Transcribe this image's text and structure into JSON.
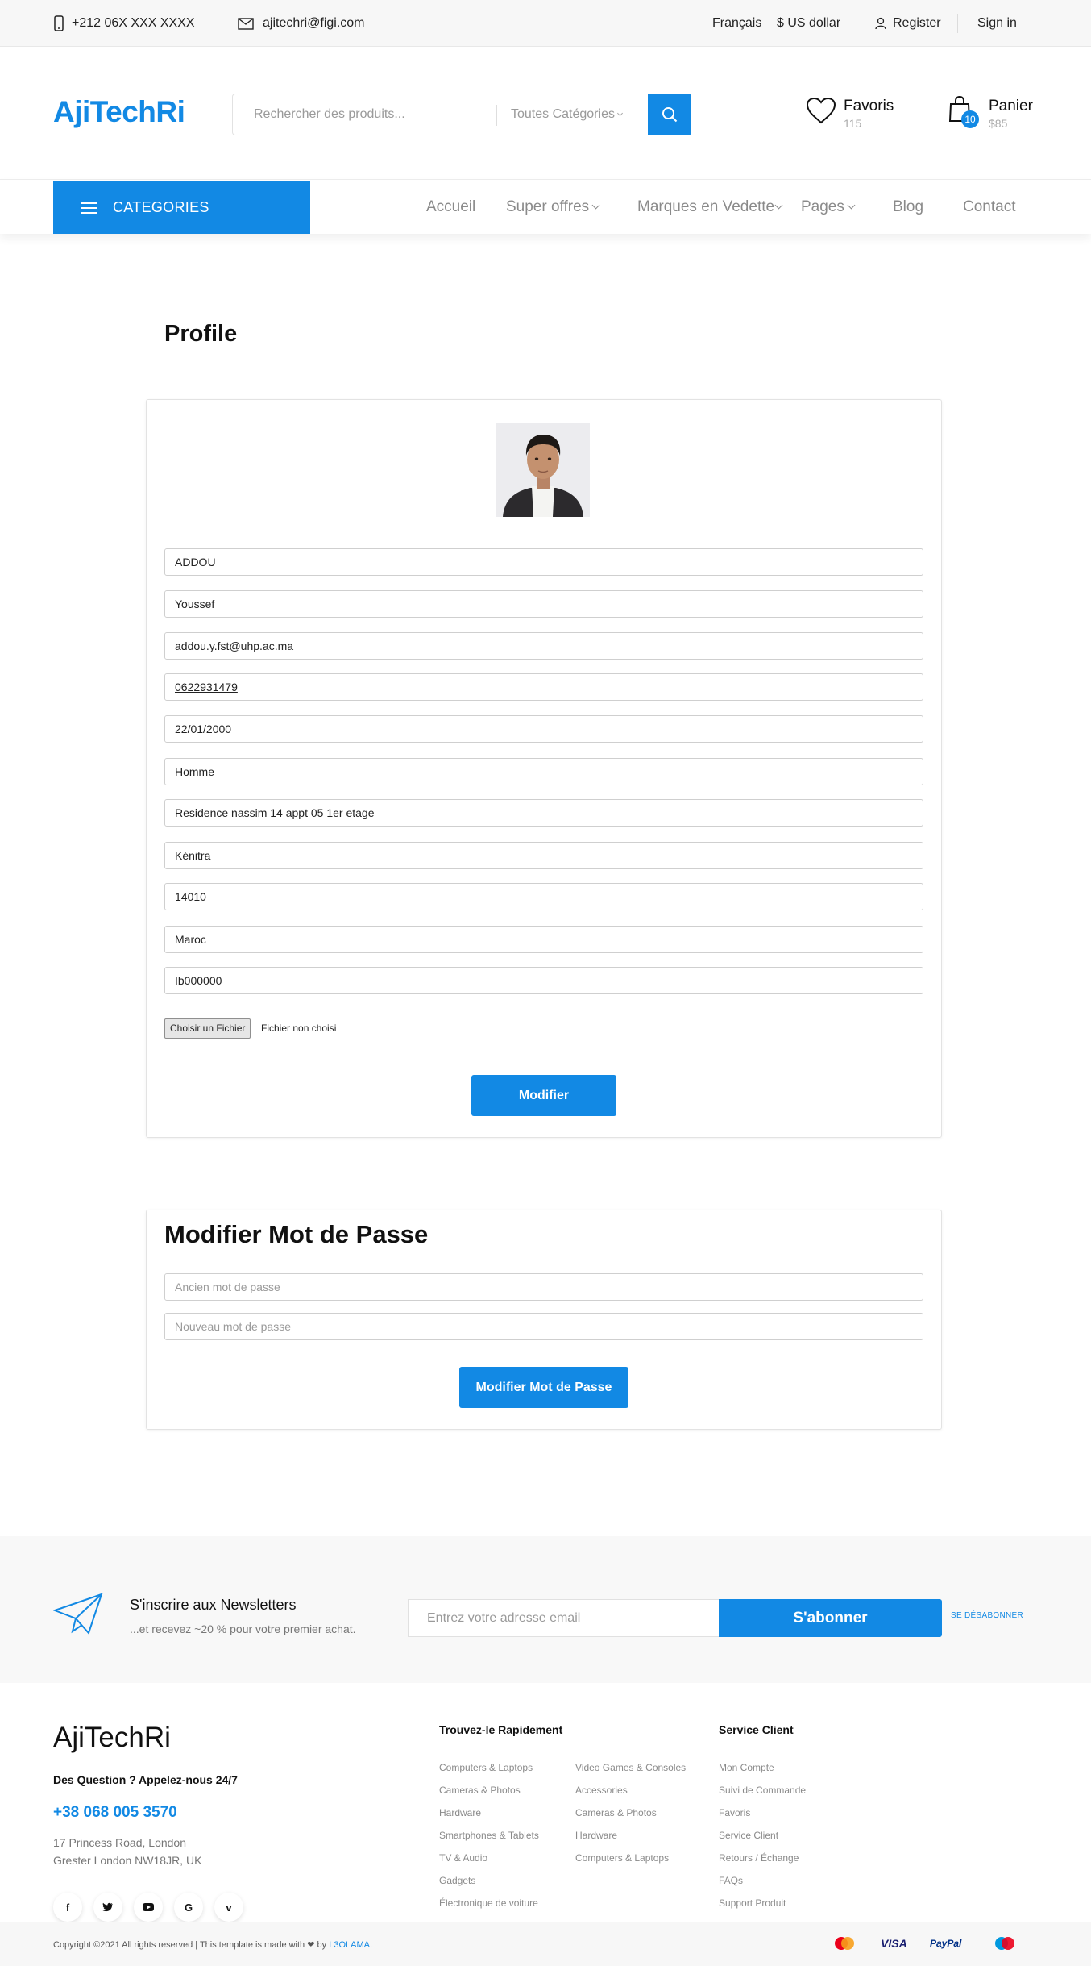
{
  "topbar": {
    "phone": "+212 06X XXX XXXX",
    "email": "ajitechri@figi.com",
    "language": "Français",
    "currency": "$ US dollar",
    "register": "Register",
    "signin": "Sign in"
  },
  "header": {
    "logo": "AjiTechRi",
    "search_placeholder": "Rechercher des produits...",
    "category_select": "Toutes Catégories",
    "favorites_label": "Favoris",
    "favorites_count": "115",
    "cart_label": "Panier",
    "cart_total": "$85",
    "cart_badge": "10"
  },
  "nav": {
    "categories": "CATEGORIES",
    "links": [
      "Accueil",
      "Super offres",
      "Marques en Vedette",
      "Pages",
      "Blog",
      "Contact"
    ]
  },
  "profile": {
    "title": "Profile",
    "fields": {
      "last_name": "ADDOU",
      "first_name": "Youssef",
      "email": "addou.y.fst@uhp.ac.ma",
      "phone": "0622931479",
      "birthdate": "22/01/2000",
      "gender": "Homme",
      "address": "Residence nassim 14 appt 05 1er etage",
      "city": "Kénitra",
      "postal_code": "14010",
      "country": "Maroc",
      "id_number": "Ib000000"
    },
    "file_button": "Choisir un Fichier",
    "file_status": "Fichier non choisi",
    "submit": "Modifier"
  },
  "password": {
    "title": "Modifier Mot de Passe",
    "old_placeholder": "Ancien mot de passe",
    "new_placeholder": "Nouveau mot de passe",
    "submit": "Modifier Mot de Passe"
  },
  "newsletter": {
    "title": "S'inscrire aux Newsletters",
    "subtitle": "...et recevez ~20 % pour votre premier achat.",
    "placeholder": "Entrez votre adresse email",
    "button": "S'abonner",
    "unsubscribe": "SE DÉSABONNER"
  },
  "footer": {
    "logo": "AjiTechRi",
    "question": "Des Question ? Appelez-nous 24/7",
    "phone": "+38 068 005 3570",
    "address_line1": "17 Princess Road, London",
    "address_line2": "Grester London NW18JR, UK",
    "social": [
      "facebook-icon",
      "twitter-icon",
      "youtube-icon",
      "google-icon",
      "vimeo-icon"
    ],
    "quick_title": "Trouvez-le Rapidement",
    "quick_col1": [
      "Computers & Laptops",
      "Cameras & Photos",
      "Hardware",
      "Smartphones & Tablets",
      "TV & Audio",
      "Gadgets",
      "Électronique de voiture"
    ],
    "quick_col2": [
      "Video Games & Consoles",
      "Accessories",
      "Cameras & Photos",
      "Hardware",
      "Computers & Laptops"
    ],
    "service_title": "Service Client",
    "service_links": [
      "Mon Compte",
      "Suivi de Commande",
      "Favoris",
      "Service Client",
      "Retours / Échange",
      "FAQs",
      "Support Produit"
    ],
    "copyright_text": "Copyright ©2021 All rights reserved | This template is made with",
    "copyright_by": "by",
    "copyright_brand": "L3OLAMA",
    "payments": [
      "mastercard-icon",
      "VISA",
      "PayPal",
      "maestro-icon"
    ]
  },
  "colors": {
    "accent": "#1289e4"
  }
}
